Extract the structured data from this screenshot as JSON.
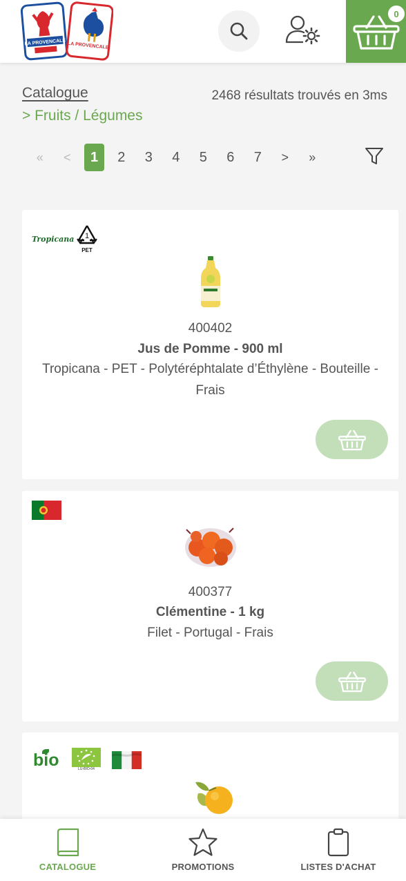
{
  "header": {
    "logo_text_1": "LA PROVENCALE",
    "logo_text_2": "LA PROVENCALE",
    "cart_count": "0",
    "accent": "#6aa84f"
  },
  "breadcrumb": {
    "title": "Catalogue",
    "sub": "> Fruits / Légumes"
  },
  "results": {
    "text": "2468 résultats trouvés en 3ms"
  },
  "pagination": {
    "first": "«",
    "prev": "<",
    "pages": [
      "1",
      "2",
      "3",
      "4",
      "5",
      "6",
      "7"
    ],
    "current": "1",
    "next": ">",
    "last": "»"
  },
  "products": [
    {
      "badges": [
        "tropicana-logo",
        "pet-recycling-icon"
      ],
      "brand_badge_text": "Tropicana",
      "recycle_number": "1",
      "recycle_label": "PET",
      "code": "400402",
      "name": "Jus de Pomme - 900 ml",
      "description": "Tropicana - PET - Polytéréphtalate d’Éthylène - Bouteille - Frais"
    },
    {
      "badges": [
        "portugal-flag"
      ],
      "code": "400377",
      "name": "Clémentine - 1 kg",
      "description": "Filet - Portugal - Frais"
    },
    {
      "badges": [
        "bio-logo",
        "eu-organic-logo",
        "italy-flag"
      ],
      "bio_text": "bio",
      "eu_organic_text": "LU-BIO-04"
    }
  ],
  "bottom_nav": {
    "items": [
      {
        "label": "CATALOGUE",
        "icon": "book-icon",
        "active": true
      },
      {
        "label": "PROMOTIONS",
        "icon": "star-icon",
        "active": false
      },
      {
        "label": "LISTES D'ACHAT",
        "icon": "clipboard-icon",
        "active": false
      }
    ]
  }
}
